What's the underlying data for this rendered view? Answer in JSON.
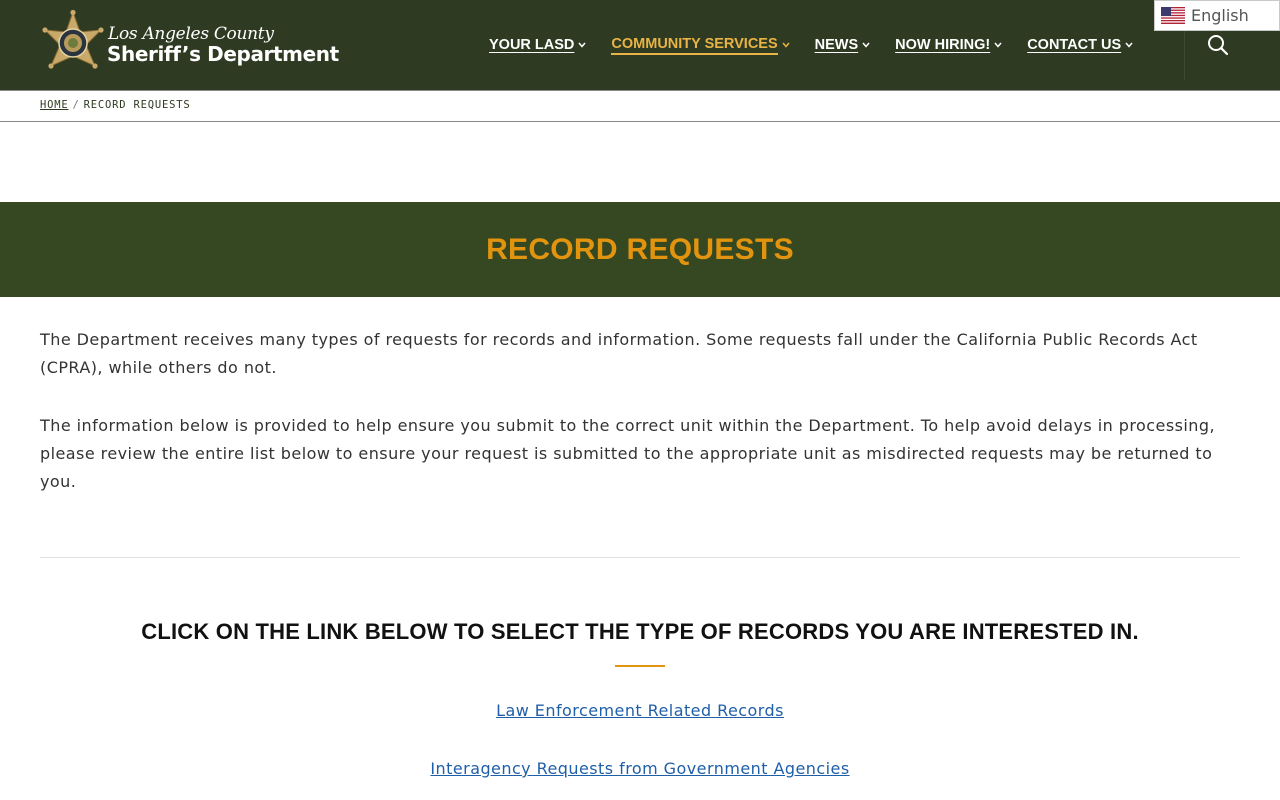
{
  "header": {
    "logo": {
      "line1": "Los Angeles County",
      "line2": "Sheriff’s Department"
    },
    "nav": [
      {
        "label": "YOUR LASD",
        "active": false
      },
      {
        "label": "COMMUNITY SERVICES",
        "active": true
      },
      {
        "label": "NEWS",
        "active": false
      },
      {
        "label": "NOW HIRING!",
        "active": false
      },
      {
        "label": "CONTACT US",
        "active": false
      }
    ],
    "search_icon": "search-icon",
    "language": {
      "label": "English",
      "flag_icon": "us-flag-icon"
    }
  },
  "breadcrumb": {
    "home": "HOME",
    "separator": "/",
    "current": "RECORD REQUESTS"
  },
  "banner": {
    "title": "RECORD REQUESTS"
  },
  "content": {
    "paragraphs": [
      "The Department receives many types of requests for records and information. Some requests fall under the California Public Records Act (CPRA), while others do not.",
      "The information below is provided to help ensure you submit to the correct unit within the Department. To help avoid delays in processing, please review the entire list below to ensure your request is submitted to the appropriate unit as misdirected requests may be returned to you."
    ],
    "cta_heading": "CLICK ON THE LINK BELOW TO SELECT THE TYPE OF RECORDS YOU ARE INTERESTED IN.",
    "links": [
      "Law Enforcement Related Records",
      "Interagency Requests from Government Agencies"
    ]
  },
  "colors": {
    "header_bg": "#2f3a22",
    "banner_bg": "#364822",
    "accent": "#e3940f",
    "active_nav": "#e8b445",
    "link": "#1f5fa8"
  }
}
